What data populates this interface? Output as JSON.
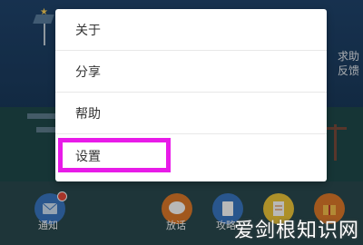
{
  "menu": {
    "items": [
      {
        "label": "关于"
      },
      {
        "label": "分享"
      },
      {
        "label": "帮助"
      },
      {
        "label": "设置"
      }
    ]
  },
  "background": {
    "side_labels": [
      "求助",
      "反馈"
    ],
    "bottom_nav": [
      {
        "label": "通知",
        "icon": "mail-icon",
        "color": "#3a78c4"
      },
      {
        "label": "放话",
        "icon": "chat-icon",
        "color": "#e07a2a"
      },
      {
        "label": "攻略",
        "icon": "book-icon",
        "color": "#3a78c4"
      },
      {
        "label": "",
        "icon": "note-icon",
        "color": "#f0c83a"
      },
      {
        "label": "",
        "icon": "gift-icon",
        "color": "#e07a2a"
      }
    ]
  },
  "watermark": "爱剑根知识网",
  "colors": {
    "highlight": "#e81be8"
  }
}
